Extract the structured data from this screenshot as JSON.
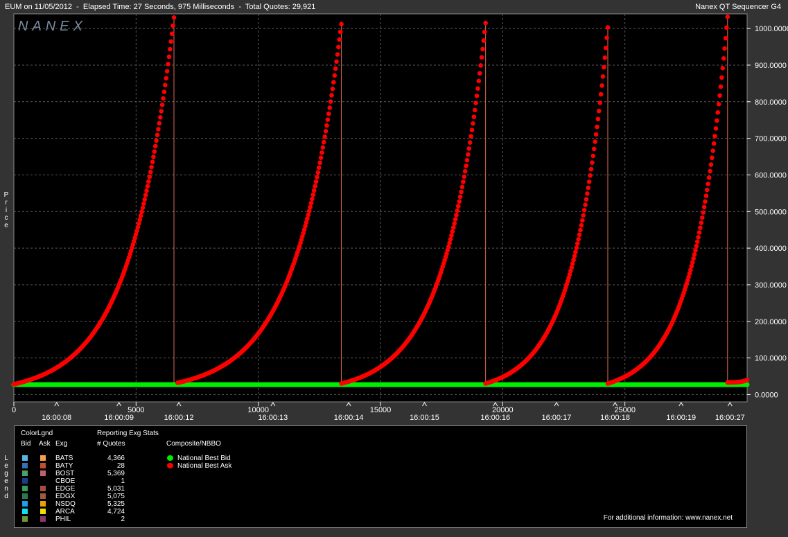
{
  "header": {
    "left": "EUM on 11/05/2012  -  Elapsed Time: 27 Seconds, 975 Milliseconds  -  Total Quotes: 29,921",
    "right": "Nanex QT Sequencer G4"
  },
  "logo": "NANEX",
  "y_axis_vertical_label": "Price",
  "legend_vertical_label": "Legend",
  "colors": {
    "background": "#000000",
    "frame": "#333333",
    "ask": "#ff0000",
    "bid": "#00ee00",
    "grid": "#5a5a5a",
    "drop_line": "#e06a50"
  },
  "chart_data": {
    "type": "scatter",
    "title": "EUM on 11/05/2012",
    "xlabel": "",
    "ylabel": "Price",
    "xlim": [
      0,
      30000
    ],
    "ylim": [
      -20,
      1040
    ],
    "x_ticks": [
      0,
      5000,
      10000,
      15000,
      20000,
      25000
    ],
    "y_ticks": [
      0,
      100,
      200,
      300,
      400,
      500,
      600,
      700,
      800,
      900,
      1000
    ],
    "y_tick_labels": [
      "0.0000",
      "100.0000",
      "200.0000",
      "300.0000",
      "400.0000",
      "500.0000",
      "600.0000",
      "700.0000",
      "800.0000",
      "900.0000",
      "1000.0000"
    ],
    "time_labels": [
      {
        "x": 1750,
        "label": "16:00:08"
      },
      {
        "x": 4300,
        "label": "16:00:09"
      },
      {
        "x": 6750,
        "label": "16:00:12"
      },
      {
        "x": 10600,
        "label": "16:00:13"
      },
      {
        "x": 13700,
        "label": "16:00:14"
      },
      {
        "x": 16800,
        "label": "16:00:15"
      },
      {
        "x": 19700,
        "label": "16:00:16"
      },
      {
        "x": 22200,
        "label": "16:00:17"
      },
      {
        "x": 24600,
        "label": "16:00:18"
      },
      {
        "x": 27300,
        "label": "16:00:19"
      },
      {
        "x": 29300,
        "label": "16:00:27"
      }
    ],
    "grid": true,
    "series": [
      {
        "name": "National Best Ask",
        "color": "#ff0000",
        "ramps": [
          {
            "x_start": 0,
            "x_end": 6550,
            "y_start": 28,
            "y_end": 1030
          },
          {
            "x_start": 6700,
            "x_end": 13400,
            "y_start": 32,
            "y_end": 1012
          },
          {
            "x_start": 13400,
            "x_end": 19300,
            "y_start": 30,
            "y_end": 1015
          },
          {
            "x_start": 19300,
            "x_end": 24300,
            "y_start": 30,
            "y_end": 1003
          },
          {
            "x_start": 24300,
            "x_end": 29200,
            "y_start": 30,
            "y_end": 1032
          },
          {
            "x_start": 29200,
            "x_end": 30000,
            "y_start": 33,
            "y_end": 40
          }
        ],
        "drops": [
          6550,
          13400,
          19300,
          24300,
          29200
        ]
      },
      {
        "name": "National Best Bid",
        "color": "#00ee00",
        "x": [
          0,
          30000
        ],
        "y": [
          27,
          27
        ]
      }
    ]
  },
  "legend": {
    "colorlgnd_title": "ColorLgnd",
    "col_bid": "Bid",
    "col_ask": "Ask",
    "col_exg": "Exg",
    "stats_title": "Reporting Exg Stats",
    "stats_col": "# Quotes",
    "composite_title": "Composite/NBBO",
    "composite_items": [
      {
        "label": "National Best Bid",
        "color": "#00ee00"
      },
      {
        "label": "National Best Ask",
        "color": "#ff0000"
      }
    ],
    "exchanges": [
      {
        "name": "BATS",
        "quotes": "4,366",
        "bid_color": "#5ab4e6",
        "ask_color": "#f0a050"
      },
      {
        "name": "BATY",
        "quotes": "28",
        "bid_color": "#3a6eb4",
        "ask_color": "#c0502a"
      },
      {
        "name": "BOST",
        "quotes": "5,369",
        "bid_color": "#4aa06a",
        "ask_color": "#c06070"
      },
      {
        "name": "CBOE",
        "quotes": "1",
        "bid_color": "#1e3c8c",
        "ask_color": ""
      },
      {
        "name": "EDGE",
        "quotes": "5,031",
        "bid_color": "#3a9a5a",
        "ask_color": "#a05040"
      },
      {
        "name": "EDGX",
        "quotes": "5,075",
        "bid_color": "#2a7a4a",
        "ask_color": "#a05a40"
      },
      {
        "name": "NSDQ",
        "quotes": "5,325",
        "bid_color": "#1ea0f0",
        "ask_color": "#f0a000"
      },
      {
        "name": "ARCA",
        "quotes": "4,724",
        "bid_color": "#10e0f0",
        "ask_color": "#f0e000"
      },
      {
        "name": "PHIL",
        "quotes": "2",
        "bid_color": "#6a9a3a",
        "ask_color": "#8a3a6a"
      }
    ],
    "footer": "For additional information: www.nanex.net"
  }
}
